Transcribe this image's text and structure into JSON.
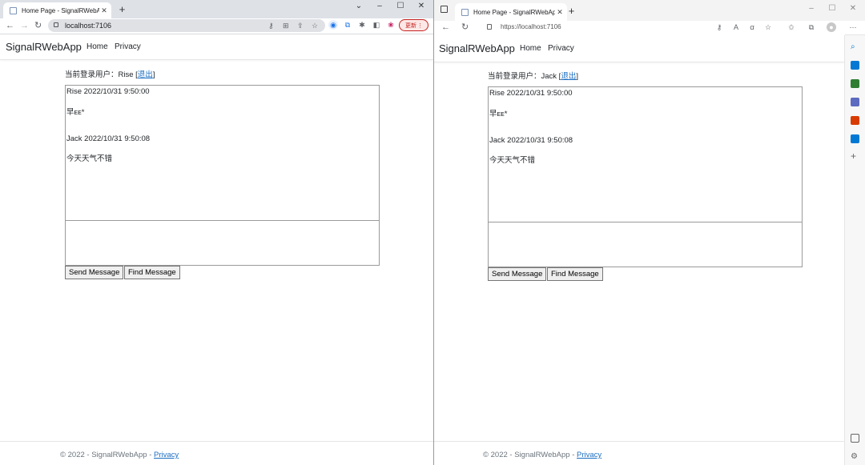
{
  "left_browser": {
    "tab_title": "Home Page - SignalRWebApp",
    "url": "localhost:7106",
    "update_label": "更新",
    "page": {
      "brand": "SignalRWebApp",
      "nav": [
        "Home",
        "Privacy"
      ],
      "user_prefix": "当前登录用户：Rise",
      "logout": "退出",
      "messages": [
        {
          "header": "Rise 2022/10/31 9:50:00",
          "body": "早ᴇᴇ*"
        },
        {
          "header": "Jack 2022/10/31 9:50:08",
          "body": "今天天气不错"
        }
      ],
      "send_button": "Send Message",
      "find_button": "Find Message",
      "footer_text": "© 2022 - SignalRWebApp - ",
      "footer_link": "Privacy"
    }
  },
  "right_browser": {
    "tab_title": "Home Page - SignalRWebApp",
    "url": "https://localhost:7106",
    "page": {
      "brand": "SignalRWebApp",
      "nav": [
        "Home",
        "Privacy"
      ],
      "user_prefix": "当前登录用户：Jack",
      "logout": "退出",
      "messages": [
        {
          "header": "Rise 2022/10/31 9:50:00",
          "body": "早ᴇᴇ*"
        },
        {
          "header": "Jack 2022/10/31 9:50:08",
          "body": "今天天气不错"
        }
      ],
      "send_button": "Send Message",
      "find_button": "Find Message",
      "footer_text": "© 2022 - SignalRWebApp - ",
      "footer_link": "Privacy"
    }
  },
  "colors": {
    "link": "#1b6ec2",
    "update_red": "#c5221f",
    "chrome_frame": "#dee1e6",
    "edge_frame": "#f3f3f3"
  }
}
